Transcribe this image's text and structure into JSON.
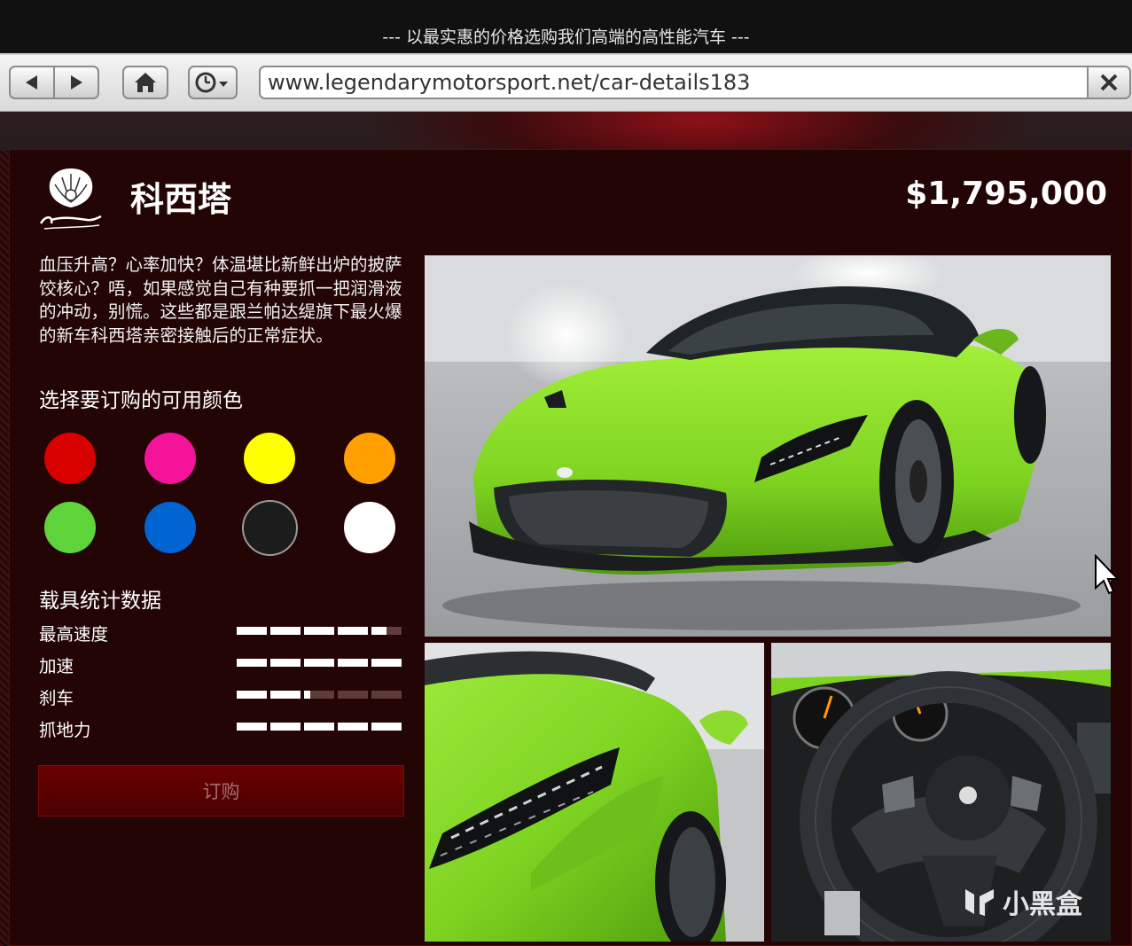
{
  "window": {
    "title": "--- 以最实惠的价格选购我们高端的高性能汽车 ---"
  },
  "browser": {
    "url": "www.legendarymotorsport.net/car-details183"
  },
  "car": {
    "brand": "Lampadati",
    "name": "科西塔",
    "price": "$1,795,000",
    "description": "血压升高？心率加快？体温堪比新鲜出炉的披萨饺核心？唔，如果感觉自己有种要抓一把润滑液的冲动，别慌。这些都是跟兰帕达缇旗下最火爆的新车科西塔亲密接触后的正常症状。",
    "body_color": "#7ed321"
  },
  "colors": {
    "heading": "选择要订购的可用颜色",
    "swatches": [
      "#d90000",
      "#f5139a",
      "#ffff00",
      "#ffa000",
      "#5ed43a",
      "#0064d2",
      "#1c1c1c",
      "#ffffff"
    ],
    "selected_index": 6
  },
  "stats": {
    "heading": "载具统计数据",
    "items": [
      {
        "label": "最高速度",
        "value": 4.5
      },
      {
        "label": "加速",
        "value": 5.0
      },
      {
        "label": "刹车",
        "value": 2.2
      },
      {
        "label": "抓地力",
        "value": 5.0
      }
    ],
    "max": 5
  },
  "order": {
    "label": "订购"
  },
  "watermark": {
    "text": "小黑盒"
  }
}
